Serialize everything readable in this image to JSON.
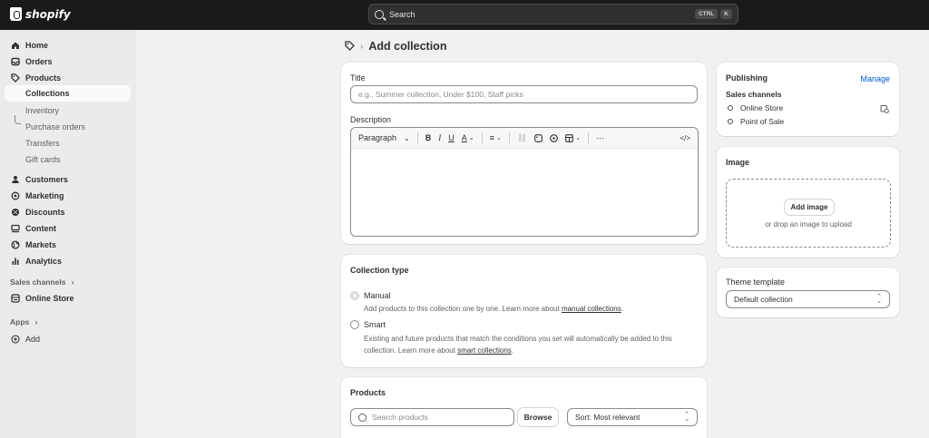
{
  "brand": {
    "name": "shopify"
  },
  "search": {
    "placeholder": "Search",
    "shortcut_ctrl": "CTRL",
    "shortcut_key": "K"
  },
  "sidebar": {
    "items": [
      {
        "label": "Home",
        "icon": "home-icon"
      },
      {
        "label": "Orders",
        "icon": "inbox-icon"
      },
      {
        "label": "Products",
        "icon": "tag-icon"
      },
      {
        "label": "Collections"
      },
      {
        "label": "Inventory"
      },
      {
        "label": "Purchase orders"
      },
      {
        "label": "Transfers"
      },
      {
        "label": "Gift cards"
      },
      {
        "label": "Customers",
        "icon": "person-icon"
      },
      {
        "label": "Marketing",
        "icon": "target-icon"
      },
      {
        "label": "Discounts",
        "icon": "discount-icon"
      },
      {
        "label": "Content",
        "icon": "content-icon"
      },
      {
        "label": "Markets",
        "icon": "globe-icon"
      },
      {
        "label": "Analytics",
        "icon": "bar-chart-icon"
      }
    ],
    "sales_channels_heading": "Sales channels",
    "online_store": "Online Store",
    "apps_heading": "Apps",
    "add_label": "Add"
  },
  "page": {
    "title": "Add collection"
  },
  "title_card": {
    "title_label": "Title",
    "title_placeholder": "e.g., Summer collection, Under $100, Staff picks",
    "description_label": "Description",
    "paragraph_label": "Paragraph"
  },
  "collection_type": {
    "heading": "Collection type",
    "manual_label": "Manual",
    "manual_help": "Add products to this collection one by one. Learn more about",
    "manual_link": "manual collections",
    "smart_label": "Smart",
    "smart_help_1": "Existing and future products that match the conditions you set will automatically be added to this",
    "smart_help_2": "collection. Learn more about",
    "smart_link": "smart collections"
  },
  "products": {
    "heading": "Products",
    "search_placeholder": "Search products",
    "browse_label": "Browse",
    "sort_label": "Sort: Most relevant"
  },
  "publishing": {
    "heading": "Publishing",
    "manage_label": "Manage",
    "sales_channels_label": "Sales channels",
    "channels": [
      "Online Store",
      "Point of Sale"
    ]
  },
  "image": {
    "heading": "Image",
    "add_label": "Add image",
    "drop_text": "or drop an image to upload"
  },
  "theme": {
    "heading": "Theme template",
    "selected": "Default collection"
  }
}
